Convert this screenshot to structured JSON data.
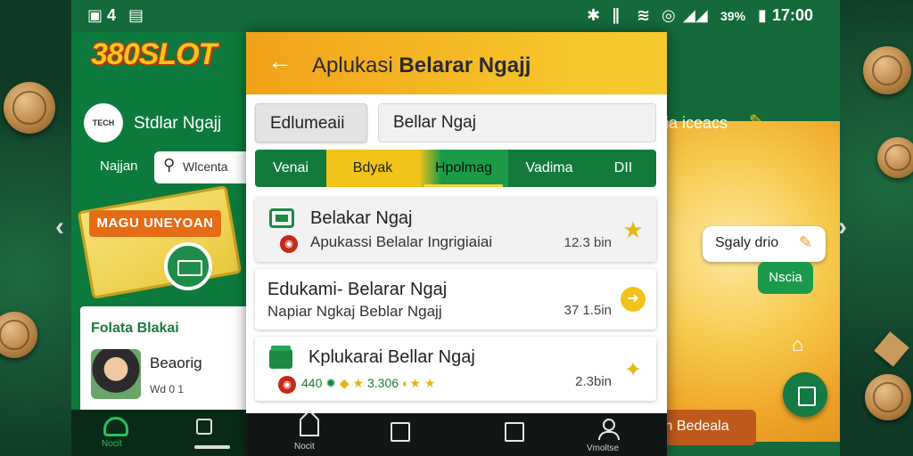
{
  "status_bar": {
    "left_text": "4",
    "right_text": "39%",
    "time": "17:00"
  },
  "left_phone": {
    "logo": "380SLOT",
    "avatar_text": "TECH",
    "title": "Stdlar Ngajj",
    "najan_label": "Najjan",
    "search_text": "Wlcenta",
    "ticket_banner": "MAGU UNEYOAN",
    "card_title": "Folata Blakai",
    "card_name": "Beaorig",
    "card_meta": "Wd 0 1"
  },
  "right_phone": {
    "header": "ia iceacs",
    "bubble_text": "Sgaly drio",
    "pill_text": "Nscia",
    "bottom_text": "ih  Bedeala"
  },
  "main": {
    "title_light": "Aplukasi ",
    "title_bold": "Belarar Ngajj",
    "category_label": "Edlumeaii",
    "search_value": "Bellar Ngaj",
    "tabs": [
      "Venai",
      "Bdyak",
      "Hpolmag",
      "Vadima",
      "DII"
    ],
    "cards": [
      {
        "title": "Belakar Ngaj",
        "subtitle": "Apukassi Belalar Ingrigiaiai",
        "size": "12.3 bin",
        "badge_icon": "star-badge-icon"
      },
      {
        "title": "Edukami- Belarar Ngaj",
        "subtitle": "Napiar Ngkaj Beblar Ngajj",
        "size": "37 1.5in",
        "badge_icon": "check-badge-icon"
      },
      {
        "title": "Kplukarai Bellar Ngaj",
        "rating_text": "3.306",
        "prefix": "440",
        "size": "2.3bin",
        "badge_icon": "star-badge-icon"
      }
    ],
    "bottom_nav": {
      "home_label": "Nocit",
      "profile_label": "Vmoltse"
    }
  },
  "colors": {
    "accent_green": "#137a3c",
    "accent_yellow": "#f0c418",
    "header_orange": "#f2a21a"
  }
}
